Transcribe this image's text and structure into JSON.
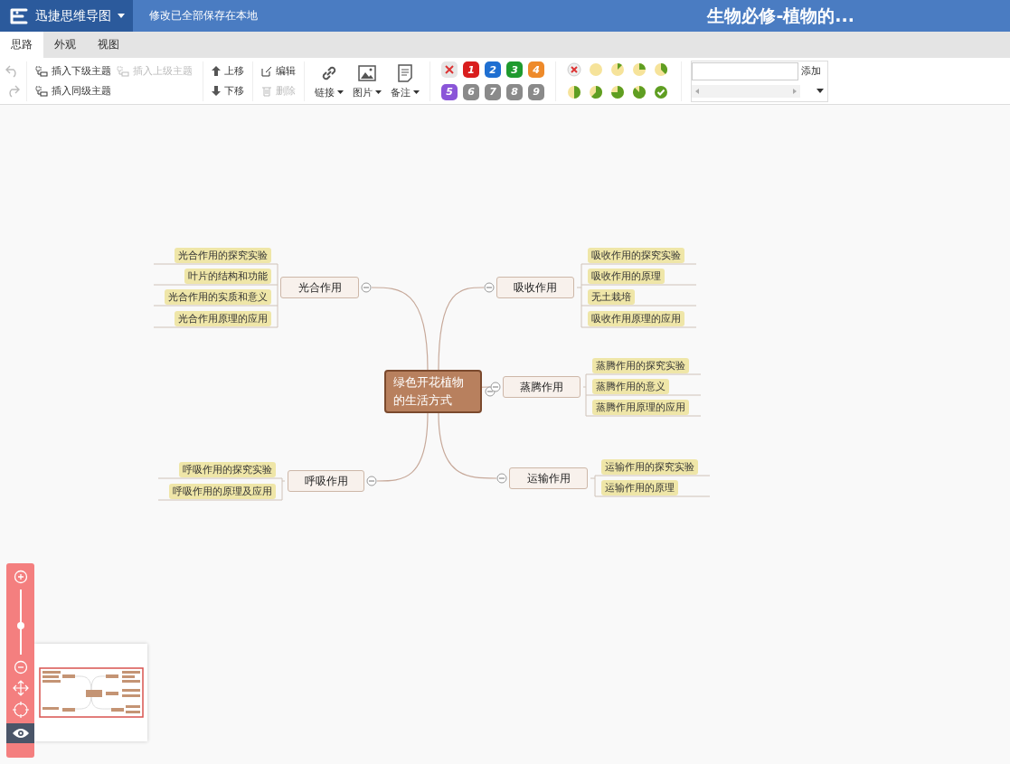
{
  "app": {
    "name": "迅捷思维导图",
    "status": "修改已全部保存在本地",
    "document_title": "生物必修-植物的..."
  },
  "tabs": [
    {
      "label": "思路",
      "selected": true
    },
    {
      "label": "外观",
      "selected": false
    },
    {
      "label": "视图",
      "selected": false
    }
  ],
  "toolbar": {
    "insert": [
      {
        "label": "插入下级主题",
        "disabled": false
      },
      {
        "label": "插入上级主题",
        "disabled": true
      },
      {
        "label": "插入同级主题",
        "disabled": false
      }
    ],
    "move": [
      {
        "label": "上移",
        "kind": "up"
      },
      {
        "label": "下移",
        "kind": "down"
      }
    ],
    "edit": [
      {
        "label": "编辑",
        "kind": "edit",
        "disabled": false
      },
      {
        "label": "删除",
        "kind": "delete",
        "disabled": true
      }
    ],
    "media": [
      {
        "label": "链接",
        "kind": "link"
      },
      {
        "label": "图片",
        "kind": "image"
      },
      {
        "label": "备注",
        "kind": "note"
      }
    ],
    "priority": [
      {
        "kind": "clear"
      },
      {
        "kind": "number",
        "label": "1",
        "color": "#d91e1e"
      },
      {
        "kind": "number",
        "label": "2",
        "color": "#1f6fd1"
      },
      {
        "kind": "number",
        "label": "3",
        "color": "#1f9a2e"
      },
      {
        "kind": "number",
        "label": "4",
        "color": "#ee8a2a"
      },
      {
        "kind": "number",
        "label": "5",
        "color": "#8a55d8"
      },
      {
        "kind": "number",
        "label": "6",
        "color": "#8a8a8a"
      },
      {
        "kind": "number",
        "label": "7",
        "color": "#8a8a8a"
      },
      {
        "kind": "number",
        "label": "8",
        "color": "#8a8a8a"
      },
      {
        "kind": "number",
        "label": "9",
        "color": "#8a8a8a"
      }
    ],
    "progress": [
      {
        "kind": "clear"
      },
      {
        "kind": "pie"
      },
      {
        "kind": "pie"
      },
      {
        "kind": "pie"
      },
      {
        "kind": "pie"
      },
      {
        "kind": "pie"
      },
      {
        "kind": "pie"
      },
      {
        "kind": "pie"
      },
      {
        "kind": "pie"
      },
      {
        "kind": "done"
      }
    ],
    "tag": {
      "button": "添加"
    }
  },
  "mindmap": {
    "root": "绿色开花植物的生活方式",
    "branches": [
      {
        "label": "光合作用",
        "children": [
          "光合作用的探究实验",
          "叶片的结构和功能",
          "光合作用的实质和意义",
          "光合作用原理的应用"
        ]
      },
      {
        "label": "吸收作用",
        "children": [
          "吸收作用的探究实验",
          "吸收作用的原理",
          "无土栽培",
          "吸收作用原理的应用"
        ]
      },
      {
        "label": "蒸腾作用",
        "children": [
          "蒸腾作用的探究实验",
          "蒸腾作用的意义",
          "蒸腾作用原理的应用"
        ]
      },
      {
        "label": "呼吸作用",
        "children": [
          "呼吸作用的探究实验",
          "呼吸作用的原理及应用"
        ]
      },
      {
        "label": "运输作用",
        "children": [
          "运输作用的探究实验",
          "运输作用的原理"
        ]
      }
    ]
  },
  "zoom": {
    "level": 0.45
  }
}
